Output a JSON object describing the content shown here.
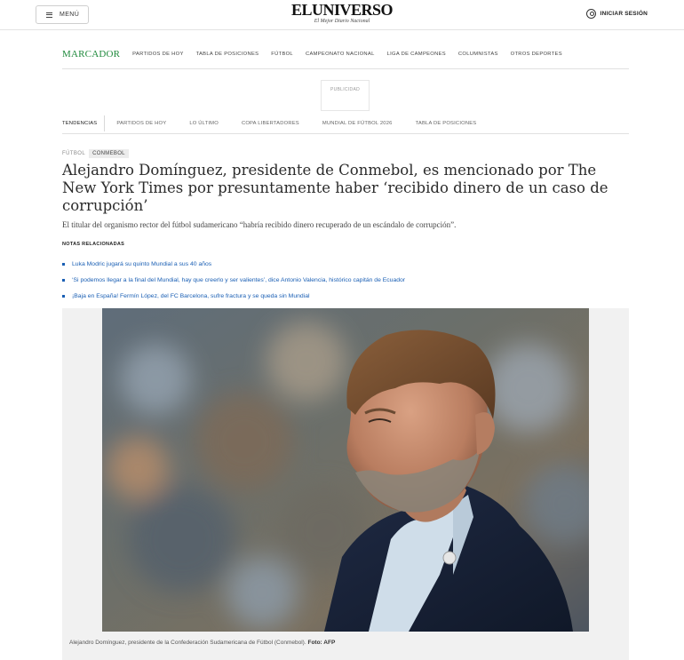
{
  "header": {
    "menu_label": "MENÚ",
    "logo": "ELUNIVERSO",
    "tagline": "El Mejor Diario Nacional",
    "login_label": "INICIAR SESIÓN"
  },
  "section_nav": {
    "brand": "MARCADOR",
    "links": [
      "PARTIDOS DE HOY",
      "TABLA DE POSICIONES",
      "FÚTBOL",
      "CAMPEONATO NACIONAL",
      "LIGA DE CAMPEONES",
      "COLUMNISTAS",
      "OTROS DEPORTES"
    ]
  },
  "ad": {
    "label": "PUBLICIDAD"
  },
  "trends": {
    "label": "TENDENCIAS",
    "links": [
      "PARTIDOS DE HOY",
      "LO ÚLTIMO",
      "COPA LIBERTADORES",
      "MUNDIAL DE FÚTBOL 2026",
      "TABLA DE POSICIONES"
    ]
  },
  "article": {
    "breadcrumb": [
      "FÚTBOL",
      "CONMEBOL"
    ],
    "headline": "Alejandro Domínguez, presidente de Conmebol, es mencionado por The New York Times por presuntamente haber ‘recibido dinero de un caso de corrupción’",
    "summary": "El titular del organismo rector del fútbol sudamericano “habría recibido dinero recuperado de un escándalo de corrupción”.",
    "related_title": "NOTAS RELACIONADAS",
    "related": [
      "Luka Modric jugará su quinto Mundial a sus 40 años",
      "‘Si podemos llegar a la final del Mundial, hay que creerlo y ser valientes’, dice Antonio Valencia, histórico capitán de Ecuador",
      "¡Baja en España! Fermín López, del FC Barcelona, sufre fractura y se queda sin Mundial"
    ],
    "caption": "Alejandro Domínguez, presidente de la Confederación Sudamericana de Fútbol (Conmebol).",
    "credit": "Foto: AFP"
  },
  "colors": {
    "brand_green": "#1f8a3c",
    "link_blue": "#1a5fb4"
  }
}
